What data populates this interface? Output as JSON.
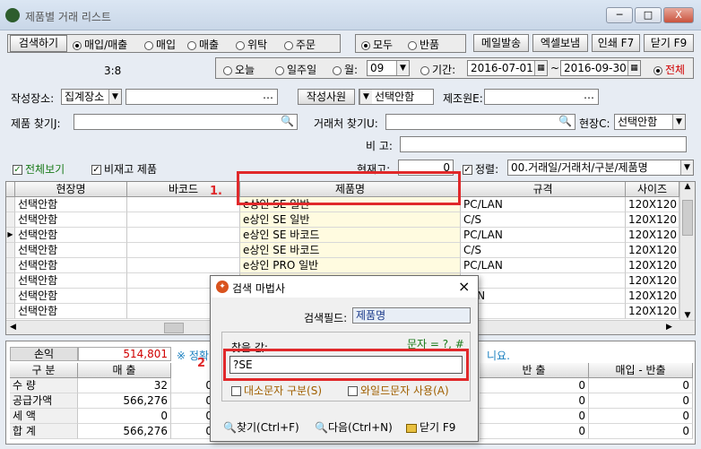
{
  "window": {
    "title": "제품별 거래 리스트",
    "controls": [
      "─",
      "□",
      "X"
    ]
  },
  "toolbar": {
    "search_button": "검색하기",
    "type_radios": [
      {
        "label": "매입/매출",
        "selected": true
      },
      {
        "label": "매입",
        "selected": false
      },
      {
        "label": "매출",
        "selected": false
      },
      {
        "label": "위탁",
        "selected": false
      },
      {
        "label": "주문",
        "selected": false
      }
    ],
    "return_radios": [
      {
        "label": "모두",
        "selected": true
      },
      {
        "label": "반품",
        "selected": false
      }
    ],
    "buttons": [
      "메일발송",
      "엑셀보냄",
      "인쇄 F7",
      "닫기 F9"
    ],
    "ratio": "3:8",
    "date_radios": [
      {
        "label": "오늘",
        "selected": false
      },
      {
        "label": "일주일",
        "selected": false
      },
      {
        "label": "월:",
        "selected": false
      },
      {
        "label": "기간:",
        "selected": false
      }
    ],
    "month_value": "09",
    "date_from": "2016-07-01",
    "date_sep": "~",
    "date_to": "2016-09-30",
    "all_label": "전체"
  },
  "filters": {
    "workplace_label": "작성장소:",
    "workplace_value": "집계장소",
    "staff_label": "작성사원",
    "staff_value": "선택안함",
    "maker_label": "제조원E:",
    "product_label": "제품 찾기J:",
    "customer_label": "거래처 찾기U:",
    "site_label": "현장C:",
    "site_value": "선택안함",
    "memo_label": "비 고:",
    "show_all_label": "전체보기",
    "no_stock_label": "비재고 제품",
    "current_stock_label": "현재고:",
    "current_stock_value": "0",
    "sort_label": "정렬:",
    "sort_value": "00.거래일/거래처/구분/제품명"
  },
  "grid": {
    "columns": [
      "현장명",
      "바코드",
      "제품명",
      "규격",
      "사이즈"
    ],
    "rows": [
      [
        "선택안함",
        "",
        "e상인 SE 일반",
        "PC/LAN",
        "120X120"
      ],
      [
        "선택안함",
        "",
        "e상인 SE 일반",
        "C/S",
        "120X120"
      ],
      [
        "선택안함",
        "",
        "e상인 SE 바코드",
        "PC/LAN",
        "120X120"
      ],
      [
        "선택안함",
        "",
        "e상인 SE 바코드",
        "C/S",
        "120X120"
      ],
      [
        "선택안함",
        "",
        "e상인 PRO 일반",
        "PC/LAN",
        "120X120"
      ],
      [
        "선택안함",
        "",
        "",
        "",
        "120X120"
      ],
      [
        "선택안함",
        "",
        "",
        "LAN",
        "120X120"
      ],
      [
        "선택안함",
        "",
        "",
        "",
        "120X120"
      ]
    ]
  },
  "annotations": {
    "marker1": "1.",
    "marker2": "2"
  },
  "summary": {
    "profit_label": "손익",
    "profit_value": "514,801",
    "notice": "※ 정확",
    "notice_tail": "니요.",
    "headers": [
      "구 분",
      "매 출",
      "반 출",
      "매입 - 반출"
    ],
    "rows": [
      {
        "label": "수 량",
        "sales": "32",
        "col3": "0",
        "col4": "0",
        "col5": "0"
      },
      {
        "label": "공급가액",
        "sales": "566,276",
        "col3": "0",
        "col4": "0",
        "col5": "0"
      },
      {
        "label": "세 액",
        "sales": "0",
        "col3": "0",
        "col4": "0",
        "col5": "0"
      },
      {
        "label": "합 계",
        "sales": "566,276",
        "col3": "0",
        "col4": "0",
        "col5": "0"
      }
    ]
  },
  "dialog": {
    "title": "검색 마법사",
    "field_label": "검색필드:",
    "field_value": "제품명",
    "find_label": "찾을 값:",
    "hint": "문자 = ?, #",
    "find_value": "?SE",
    "case_label": "대소문자 구분(S)",
    "wildcard_label": "와일드문자 사용(A)",
    "find_button": "찾기(Ctrl+F)",
    "next_button": "다음(Ctrl+N)",
    "close_button": "닫기 F9"
  }
}
